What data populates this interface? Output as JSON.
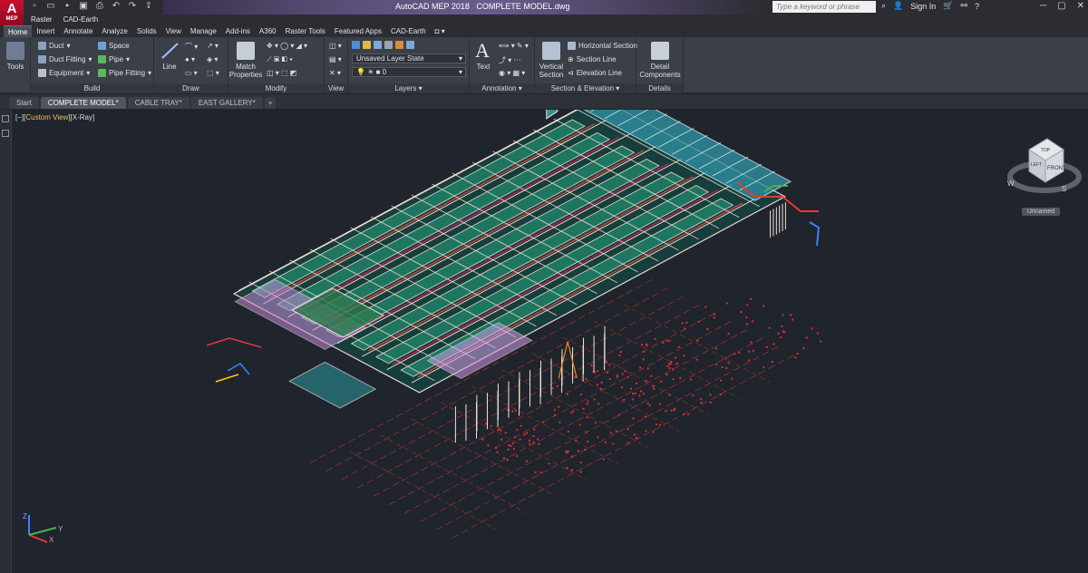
{
  "app": {
    "logo_letter": "A",
    "logo_sub": "MEP",
    "title": "AutoCAD MEP 2018   COMPLETE MODEL.dwg"
  },
  "search": {
    "placeholder": "Type a keyword or phrase"
  },
  "account": {
    "sign_in": "Sign In"
  },
  "menu_top": [
    "Raster",
    "CAD-Earth"
  ],
  "ribbon_tabs": [
    "Home",
    "Insert",
    "Annotate",
    "Analyze",
    "Solids",
    "View",
    "Manage",
    "Add-ins",
    "A360",
    "Raster Tools",
    "Featured Apps",
    "CAD-Earth"
  ],
  "ribbon": {
    "tools": {
      "label": "Tools"
    },
    "build": {
      "title": "Build",
      "items": [
        "Duct",
        "Duct Fitting",
        "Equipment",
        "Space",
        "Pipe",
        "Pipe Fitting"
      ]
    },
    "draw": {
      "title": "Draw",
      "line": "Line"
    },
    "modify": {
      "title": "Modify",
      "match_properties": "Match Properties"
    },
    "view": {
      "title": "View"
    },
    "layers": {
      "title": "Layers",
      "layer_state": "Unsaved Layer State",
      "current_layer": "0"
    },
    "annotation": {
      "title": "Annotation",
      "text": "Text"
    },
    "section": {
      "title": "Section & Elevation",
      "vertical_section": "Vertical Section",
      "horizontal_section": "Horizontal Section",
      "section_line": "Section Line",
      "elevation_line": "Elevation Line"
    },
    "details": {
      "title": "Details",
      "detail_components": "Detail Components"
    }
  },
  "doc_tabs": [
    "Start",
    "COMPLETE MODEL*",
    "CABLE TRAY*",
    "EAST GALLERY*"
  ],
  "viewport": {
    "label_prefix": "[−][",
    "view": "Custom View",
    "label_suffix": "][X-Ray]"
  },
  "viewcube": {
    "top": "TOP",
    "left": "LEFT",
    "front": "FRONT",
    "west": "W",
    "south": "S",
    "ucs_name": "Unnamed"
  },
  "ucs": {
    "x": "X",
    "y": "Y",
    "z": "Z"
  },
  "colors": {
    "accent": "#c8102e",
    "background": "#20242d",
    "ribbon": "#3b3f47"
  }
}
